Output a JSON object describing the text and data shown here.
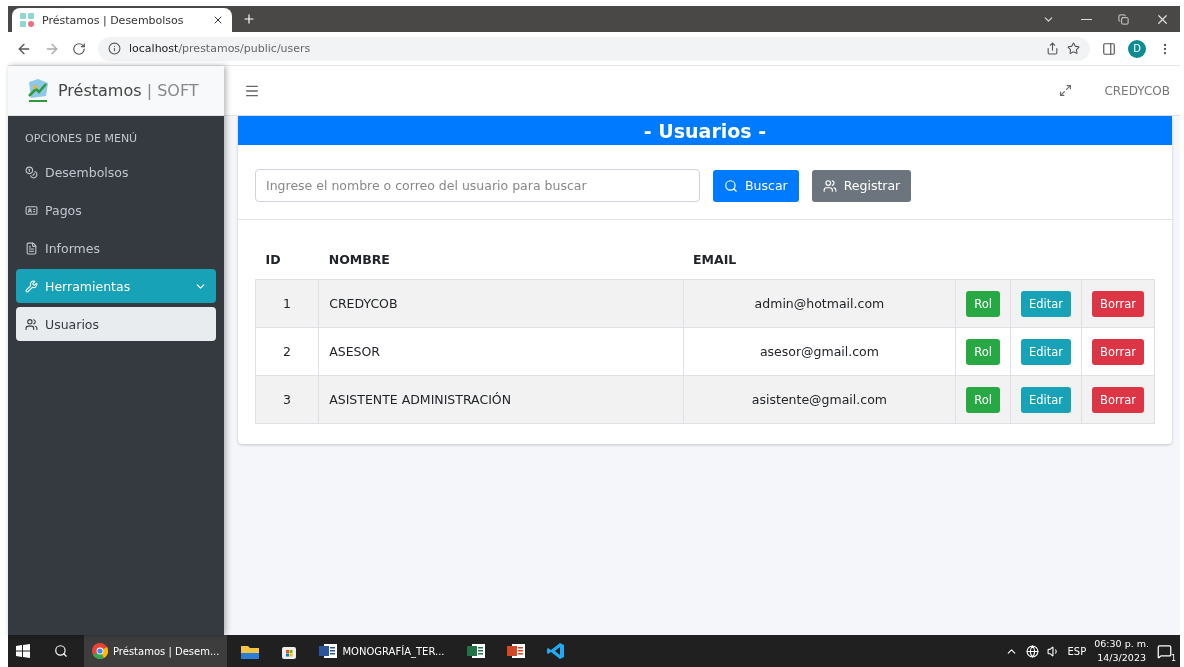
{
  "browser": {
    "tab": {
      "title": "Préstamos | Desembolsos"
    },
    "address": {
      "host": "localhost",
      "path": "/prestamos/public/users"
    },
    "profile": "D"
  },
  "header": {
    "brand": "Préstamos",
    "brand_separator": "|",
    "brand_suffix": "SOFT",
    "user": "CREDYCOB"
  },
  "sidebar": {
    "heading": "OPCIONES DE MENÚ",
    "items": [
      {
        "label": "Desembolsos",
        "kind": "coins",
        "selected": false
      },
      {
        "label": "Pagos",
        "kind": "card",
        "selected": false
      },
      {
        "label": "Informes",
        "kind": "file",
        "selected": false
      },
      {
        "label": "Herramientas",
        "kind": "wrench",
        "selected": true,
        "expanded": true,
        "children": [
          {
            "label": "Usuarios",
            "kind": "users",
            "selected": true
          }
        ]
      }
    ]
  },
  "page": {
    "title": "- Usuarios -",
    "search": {
      "placeholder": "Ingrese el nombre o correo del usuario para buscar"
    },
    "buttons": [
      {
        "label": "Buscar",
        "kind": "search"
      },
      {
        "label": "Registrar",
        "kind": "users"
      }
    ]
  },
  "table": {
    "columns": [
      "ID",
      "NOMBRE",
      "EMAIL"
    ],
    "rows": [
      {
        "id": "1",
        "name": "CREDYCOB",
        "email": "admin@hotmail.com",
        "actions": [
          {
            "label": "Rol",
            "kind": "success"
          },
          {
            "label": "Editar",
            "kind": "info"
          },
          {
            "label": "Borrar",
            "kind": "danger"
          }
        ]
      },
      {
        "id": "2",
        "name": "ASESOR",
        "email": "asesor@gmail.com",
        "actions": [
          {
            "label": "Rol",
            "kind": "success"
          },
          {
            "label": "Editar",
            "kind": "info"
          },
          {
            "label": "Borrar",
            "kind": "danger"
          }
        ]
      },
      {
        "id": "3",
        "name": "ASISTENTE ADMINISTRACIÓN",
        "email": "asistente@gmail.com",
        "actions": [
          {
            "label": "Rol",
            "kind": "success"
          },
          {
            "label": "Editar",
            "kind": "info"
          },
          {
            "label": "Borrar",
            "kind": "danger"
          }
        ]
      }
    ]
  },
  "taskbar": {
    "apps": [
      {
        "kind": "chrome",
        "label": "Préstamos | Desem...",
        "selected": true
      },
      {
        "kind": "explorer",
        "selected": false
      },
      {
        "kind": "store",
        "selected": false
      },
      {
        "kind": "word",
        "label": "MONOGRAFÍA_TER...",
        "selected": false
      },
      {
        "kind": "excel",
        "selected": false
      },
      {
        "kind": "powerpoint",
        "selected": false
      },
      {
        "kind": "vscode",
        "selected": false
      }
    ],
    "language": "ESP",
    "time": "06:30 p. m.",
    "date": "14/3/2023",
    "notifications": "1"
  }
}
